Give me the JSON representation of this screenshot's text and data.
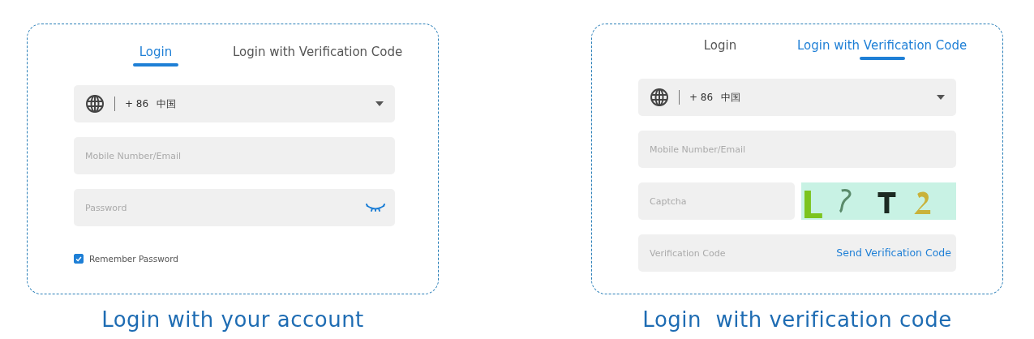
{
  "panels": [
    {
      "tabs": [
        {
          "label": "Login",
          "selected": true
        },
        {
          "label": "Login with Verification Code",
          "selected": false
        }
      ],
      "fields": [
        {
          "kind": "region",
          "code": "+ 86",
          "country": "中国"
        },
        {
          "kind": "input",
          "placeholder": "Mobile Number/Email"
        },
        {
          "kind": "password",
          "placeholder": "Password"
        }
      ],
      "remember": {
        "label": "Remember Password",
        "checked": true
      },
      "caption": "Login with your account"
    },
    {
      "tabs": [
        {
          "label": "Login",
          "selected": false
        },
        {
          "label": "Login with Verification Code",
          "selected": true
        }
      ],
      "fields": [
        {
          "kind": "region",
          "code": "+ 86",
          "country": "中国"
        },
        {
          "kind": "input",
          "placeholder": "Mobile Number/Email"
        },
        {
          "kind": "captcha",
          "placeholder": "Captcha"
        },
        {
          "kind": "code",
          "placeholder": "Verification Code",
          "action": "Send Verification Code"
        }
      ],
      "caption": "Login  with verification code"
    }
  ]
}
